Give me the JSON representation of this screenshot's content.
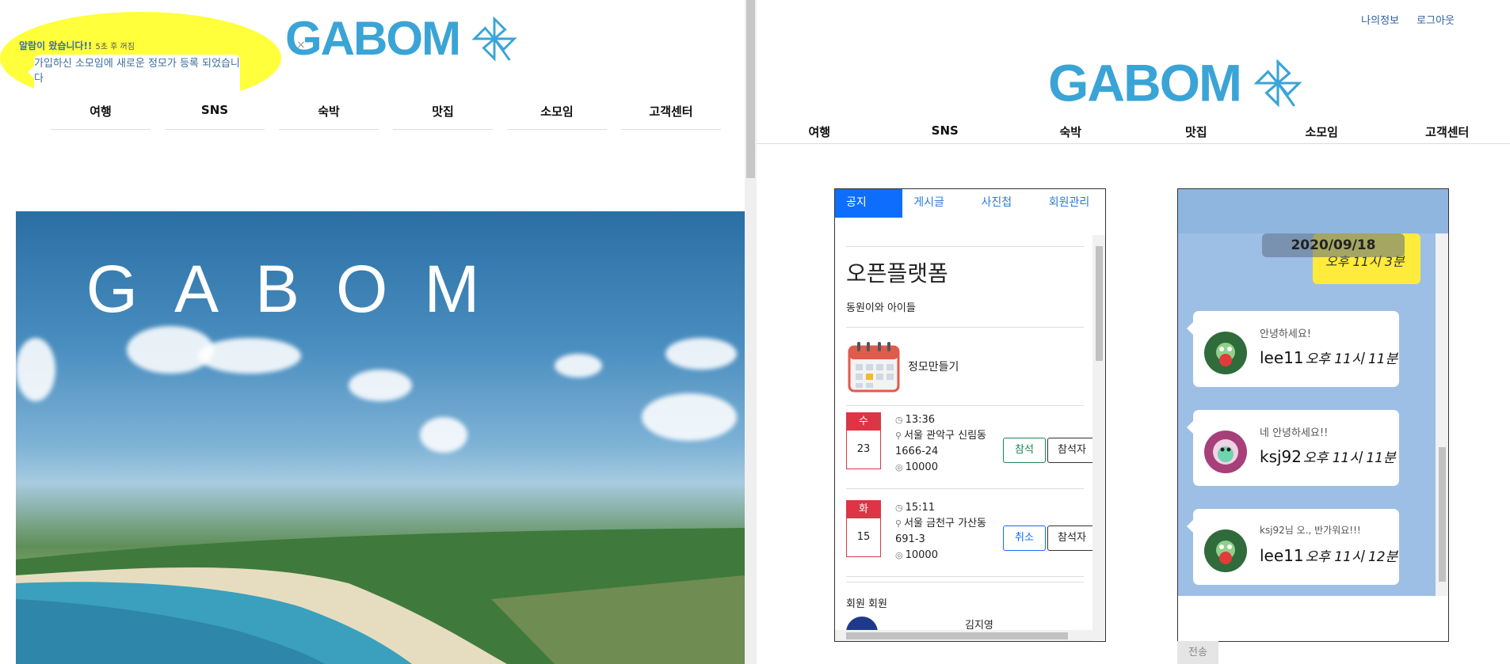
{
  "left": {
    "logo_text": "GABOM",
    "notification": {
      "title": "알람이 왔습니다!!",
      "time": "5초 후 꺼짐",
      "message": "가입하신 소모임에 새로운 정모가 등록 되었습니다",
      "close": "×"
    },
    "nav": [
      "여행",
      "SNS",
      "숙박",
      "맛집",
      "소모임",
      "고객센터"
    ],
    "hero_title": "GABOM"
  },
  "right": {
    "top_links": {
      "profile": "나의정보",
      "logout": "로그아웃"
    },
    "logo_text": "GABOM",
    "nav": [
      "여행",
      "SNS",
      "숙박",
      "맛집",
      "소모임",
      "고객센터"
    ],
    "club": {
      "tabs": [
        "공지",
        "게시글",
        "사진첩",
        "회원관리"
      ],
      "title": "오픈플랫폼",
      "subtitle": "동원이와 아이들",
      "create_meeting": "정모만들기",
      "meetings": [
        {
          "dow": "수",
          "day": "23",
          "time": "13:36",
          "place": "서울 관악구 신림동 1666-24",
          "fee": "10000",
          "action": "참석",
          "attendees": "참석자"
        },
        {
          "dow": "화",
          "day": "15",
          "time": "15:11",
          "place": "서울 금천구 가산동 691-3",
          "fee": "10000",
          "action": "취소",
          "attendees": "참석자"
        }
      ],
      "members_title": "회원 회원",
      "member_name": "김지영"
    },
    "chat": {
      "date": "2020/09/18",
      "my_time": "오후 11시 3분",
      "messages": [
        {
          "text": "안녕하세요!",
          "user": "lee11",
          "time": "오후 11시 11분"
        },
        {
          "text": "네 안녕하세요!!",
          "user": "ksj92",
          "time": "오후 11시 11분"
        },
        {
          "text": "ksj92님 오., 반가워요!!!",
          "user": "lee11",
          "time": "오후 11시 12분"
        }
      ],
      "send_label": "전송"
    }
  },
  "colors": {
    "brand_blue": "#3aa4d6",
    "highlight": "#ffff33",
    "primary": "#0d6efd",
    "danger": "#dc3545",
    "chat_bg": "#9dbfe6",
    "my_bubble": "#ffeb3b"
  }
}
